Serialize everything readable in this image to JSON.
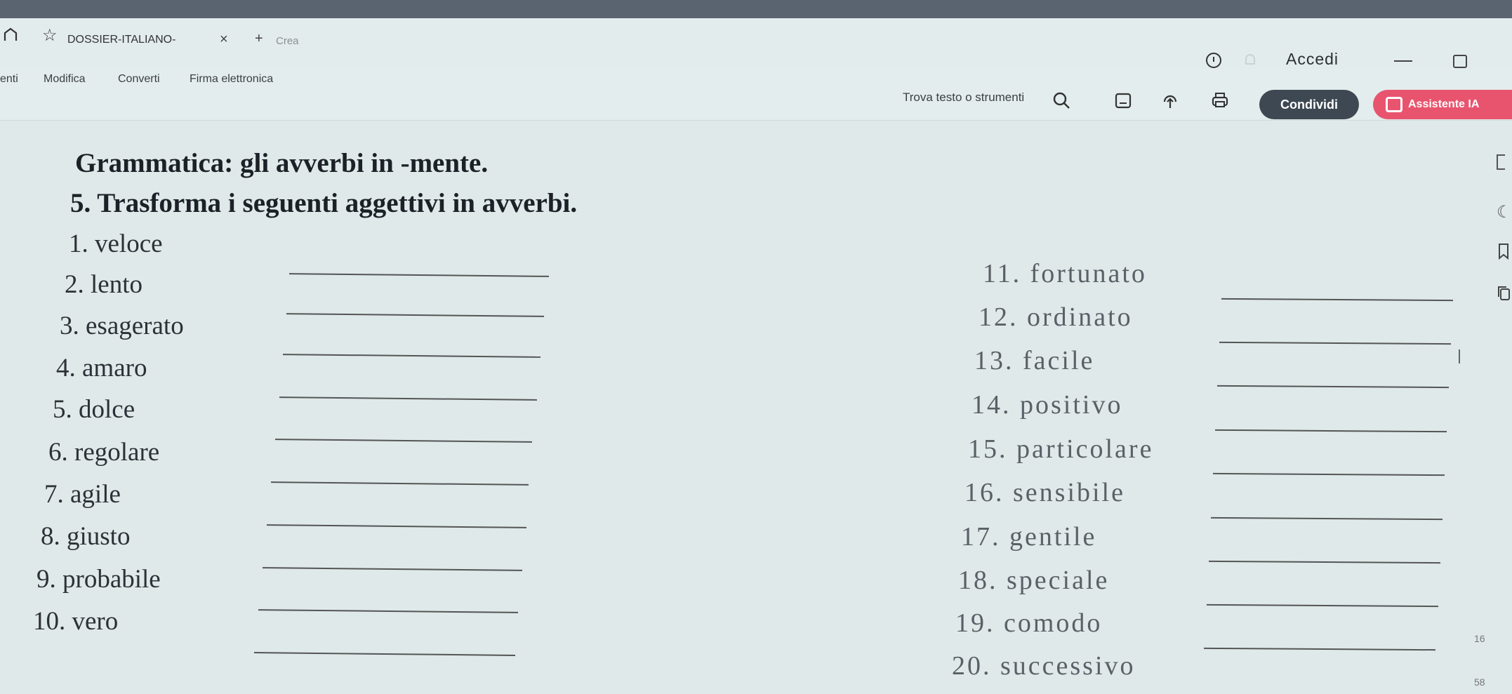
{
  "browser": {
    "tab_title": "DOSSIER-ITALIANO-",
    "close_glyph": "×",
    "new_tab_glyph": "+",
    "new_tab_label": "Crea",
    "login_label": "Accedi"
  },
  "menu": {
    "partial_label": "enti",
    "items": [
      "Modifica",
      "Converti",
      "Firma elettronica"
    ]
  },
  "toolbar": {
    "search_placeholder": "Trova testo o strumenti",
    "share_label": "Condividi",
    "assistant_label": "Assistente IA"
  },
  "document": {
    "title": "Grammatica: gli avverbi in -mente.",
    "instruction": "5. Trasforma i seguenti aggettivi in avverbi.",
    "left_items": [
      "1. veloce",
      "2. lento",
      "3. esagerato",
      "4. amaro",
      "5. dolce",
      "6. regolare",
      "7. agile",
      "8. giusto",
      "9. probabile",
      "10. vero"
    ],
    "right_items": [
      "11. fortunato",
      "12. ordinato",
      "13. facile",
      "14. positivo",
      "15. particolare",
      "16. sensibile",
      "17. gentile",
      "18. speciale",
      "19. comodo",
      "20. successivo"
    ],
    "page_marks": [
      "16",
      "58"
    ]
  },
  "colors": {
    "share_button": "#3d4852",
    "assistant_button": "#e8546e",
    "background": "#dfe9e9"
  }
}
